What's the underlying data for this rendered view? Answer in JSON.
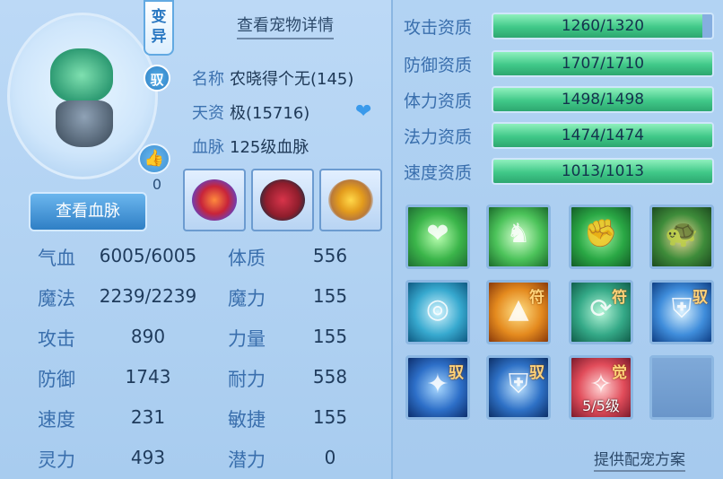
{
  "header": {
    "mutate_tag": "变异",
    "ride_badge": "驭",
    "like_count": "0",
    "detail_link": "查看宠物详情"
  },
  "info": {
    "name_label": "名称",
    "name_value": "农晓得个无(145)",
    "talent_label": "天资",
    "talent_value": "极(15716)",
    "bloodline_label": "血脉",
    "bloodline_value": "125级血脉"
  },
  "equipment": [
    {
      "name": "collar"
    },
    {
      "name": "armor"
    },
    {
      "name": "amulet"
    }
  ],
  "bloodline_button": "查看血脉",
  "stats": [
    {
      "label": "气血",
      "value": "6005/6005",
      "label2": "体质",
      "value2": "556"
    },
    {
      "label": "魔法",
      "value": "2239/2239",
      "label2": "魔力",
      "value2": "155"
    },
    {
      "label": "攻击",
      "value": "890",
      "label2": "力量",
      "value2": "155"
    },
    {
      "label": "防御",
      "value": "1743",
      "label2": "耐力",
      "value2": "558"
    },
    {
      "label": "速度",
      "value": "231",
      "label2": "敏捷",
      "value2": "155"
    },
    {
      "label": "灵力",
      "value": "493",
      "label2": "潜力",
      "value2": "0"
    }
  ],
  "aptitudes": [
    {
      "label": "攻击资质",
      "text": "1260/1320",
      "fraction": 0.9545
    },
    {
      "label": "防御资质",
      "text": "1707/1710",
      "fraction": 0.9982
    },
    {
      "label": "体力资质",
      "text": "1498/1498",
      "fraction": 1.0
    },
    {
      "label": "法力资质",
      "text": "1474/1474",
      "fraction": 1.0
    },
    {
      "label": "速度资质",
      "text": "1013/1013",
      "fraction": 1.0
    }
  ],
  "skills": [
    {
      "icon": "winged-heart-icon",
      "badge": "",
      "level": ""
    },
    {
      "icon": "charging-horse-icon",
      "badge": "",
      "level": ""
    },
    {
      "icon": "green-giant-icon",
      "badge": "",
      "level": ""
    },
    {
      "icon": "turtle-icon",
      "badge": "",
      "level": ""
    },
    {
      "icon": "cauldron-shield-icon",
      "badge": "",
      "level": ""
    },
    {
      "icon": "totem-shield-icon",
      "badge": "符",
      "level": ""
    },
    {
      "icon": "spiral-shield-icon",
      "badge": "符",
      "level": ""
    },
    {
      "icon": "sword-shield-icon",
      "badge": "驭",
      "level": ""
    },
    {
      "icon": "blue-warrior-icon",
      "badge": "驭",
      "level": ""
    },
    {
      "icon": "blue-shield-icon",
      "badge": "驭",
      "level": ""
    },
    {
      "icon": "red-spirit-icon",
      "badge": "觉",
      "level": "5/5级"
    },
    {
      "icon": "empty-slot-icon",
      "badge": "",
      "level": ""
    }
  ],
  "plan_link": "提供配宠方案",
  "colors": {
    "accent_blue": "#3a6fad",
    "bar_green": "#40c888",
    "bar_track": "#86aee0"
  }
}
